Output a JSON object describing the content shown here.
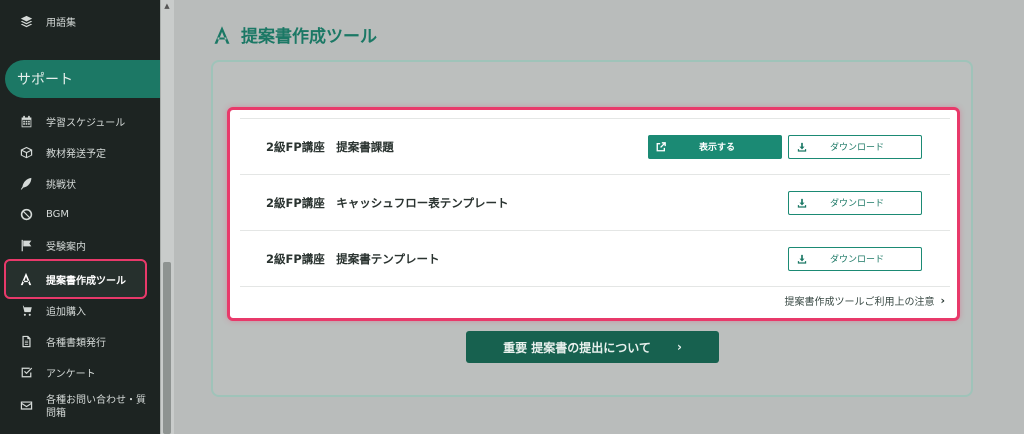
{
  "sidebar": {
    "glossary_label": "用語集",
    "support_label": "サポート",
    "items": [
      {
        "label": "学習スケジュール",
        "icon": "calendar-icon"
      },
      {
        "label": "教材発送予定",
        "icon": "box-icon"
      },
      {
        "label": "挑戦状",
        "icon": "feather-icon"
      },
      {
        "label": "BGM",
        "icon": "music-disc-icon"
      },
      {
        "label": "受験案内",
        "icon": "flag-icon"
      },
      {
        "label": "提案書作成ツール",
        "icon": "compass-icon"
      },
      {
        "label": "追加購入",
        "icon": "cart-icon"
      },
      {
        "label": "各種書類発行",
        "icon": "document-icon"
      },
      {
        "label": "アンケート",
        "icon": "checkbox-icon"
      },
      {
        "label": "各種お問い合わせ・質",
        "label2": "問箱",
        "icon": "mail-icon"
      }
    ]
  },
  "main": {
    "title": "提案書作成ツール",
    "rows": [
      {
        "title": "2級FP講座　提案書課題",
        "view_label": "表示する",
        "download_label": "ダウンロード"
      },
      {
        "title": "2級FP講座　キャッシュフロー表テンプレート",
        "download_label": "ダウンロード"
      },
      {
        "title": "2級FP講座　提案書テンプレート",
        "download_label": "ダウンロード"
      }
    ],
    "notice_link": "提案書作成ツールご利用上の注意",
    "important_button": "重要 提案書の提出について"
  },
  "colors": {
    "brand": "#1b7865",
    "highlight": "#e8396a",
    "sidebar_bg": "#1d2422"
  }
}
